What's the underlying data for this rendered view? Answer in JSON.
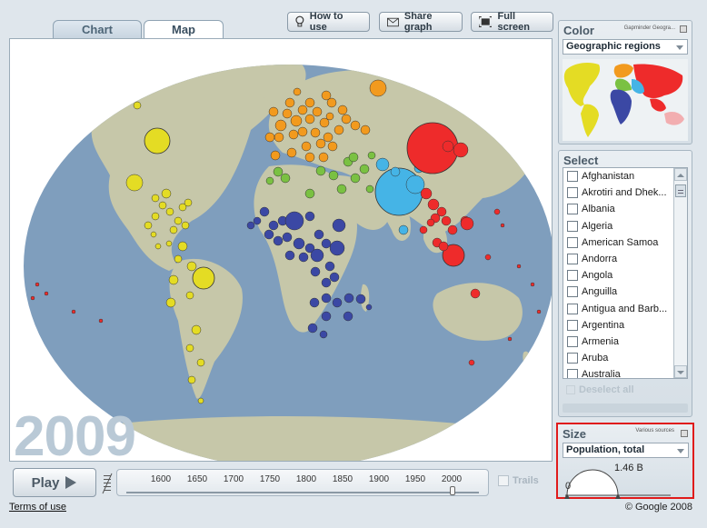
{
  "tabs": [
    {
      "label": "Chart"
    },
    {
      "label": "Map"
    }
  ],
  "toolbar": {
    "how_to_use": "How to use",
    "share_graph": "Share graph",
    "full_screen": "Full screen"
  },
  "map": {
    "year": "2009",
    "colors": {
      "ocean": "#7f9ebd",
      "land": "#c6c7a9",
      "americas": "#e4dc24",
      "europe": "#f29a1e",
      "africa": "#3b48a4",
      "middle_east": "#7ac142",
      "south_asia": "#45b4e6",
      "east_asia": "#ee2b2b"
    }
  },
  "timeline": {
    "play_label": "Play",
    "ticks": [
      "1600",
      "1650",
      "1700",
      "1750",
      "1800",
      "1850",
      "1900",
      "1950",
      "2000"
    ],
    "trails_label": "Trails"
  },
  "color_panel": {
    "title": "Color",
    "source": "Gapminder Geogra...",
    "selected": "Geographic regions"
  },
  "select_panel": {
    "title": "Select",
    "items": [
      "Afghanistan",
      "Akrotiri and Dhek...",
      "Albania",
      "Algeria",
      "American Samoa",
      "Andorra",
      "Angola",
      "Anguilla",
      "Antigua and Barb...",
      "Argentina",
      "Armenia",
      "Aruba",
      "Australia"
    ],
    "deselect_label": "Deselect all"
  },
  "size_panel": {
    "title": "Size",
    "source": "Various sources",
    "selected": "Population, total",
    "min_label": "0",
    "max_label": "1.46 B"
  },
  "footer": {
    "terms": "Terms of use",
    "copyright": "© Google 2008"
  }
}
